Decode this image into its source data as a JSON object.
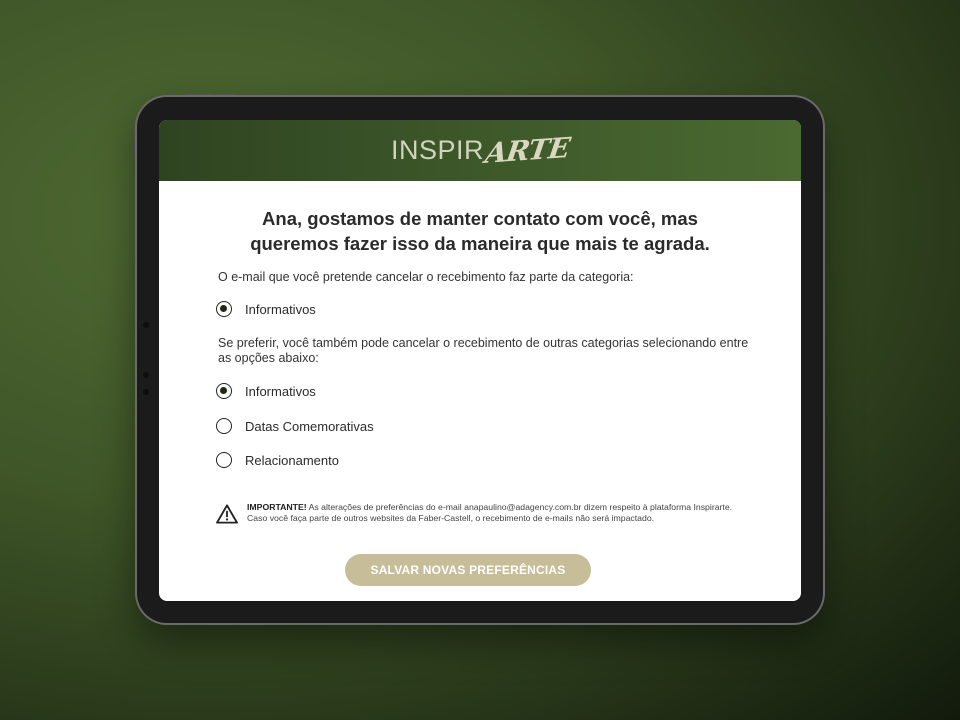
{
  "header": {
    "logo_text": "INSPIR",
    "logo_script": "ARTE"
  },
  "title": {
    "line1": "Ana, gostamos de manter contato com você, mas",
    "line2": "queremos fazer isso da maneira que mais te agrada."
  },
  "intro_text": "O e-mail que você pretende cancelar o recebimento faz parte da categoria:",
  "current_category": {
    "label": "Informativos",
    "checked": true
  },
  "secondary_text": "Se preferir, você também pode cancelar o recebimento de outras categorias selecionando entre as opções abaixo:",
  "options": [
    {
      "label": "Informativos",
      "checked": true
    },
    {
      "label": "Datas Comemorativas",
      "checked": false
    },
    {
      "label": "Relacionamento",
      "checked": false
    }
  ],
  "notice": {
    "strong": "IMPORTANTE!",
    "text": " As alterações de preferências do e-mail anapaulino@adagency.com.br dizem respeito à plataforma Inspirarte. Caso você faça parte de outros websites da Faber-Castell, o recebimento de e-mails não será impactado."
  },
  "save_button": "SALVAR NOVAS PREFERÊNCIAS",
  "colors": {
    "header_green": "#3c5629",
    "button_beige": "#c7bd99",
    "background_green": "#3f5628"
  }
}
